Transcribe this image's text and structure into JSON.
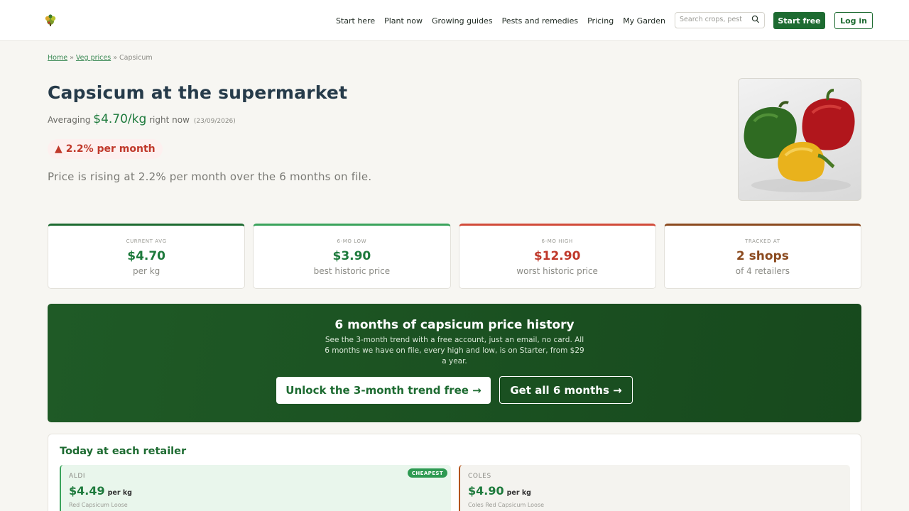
{
  "colors": {
    "brand_green": "#1d6b31",
    "price_green": "#1d7a3c",
    "rise_red": "#c0392b",
    "low_accent": "#3aa35c",
    "high_accent": "#d24b3a",
    "tracked_accent": "#8b4a1f"
  },
  "header": {
    "nav": [
      "Start here",
      "Plant now",
      "Growing guides",
      "Pests and remedies",
      "Pricing",
      "My Garden"
    ],
    "search_placeholder": "Search crops, pest",
    "start_label": "Start free",
    "login_label": "Log in",
    "logo_icon": "veggie-logo-icon",
    "search_icon": "search-icon"
  },
  "breadcrumb": {
    "home": "Home",
    "sep1": " » ",
    "prices": "Veg prices",
    "sep2": " » ",
    "current": "Capsicum"
  },
  "hero": {
    "title": "Capsicum at the supermarket",
    "avg_prefix": "Averaging ",
    "avg_price": "$4.70/kg",
    "avg_suffix": " right now",
    "date": "(23/09/2026)",
    "trend_arrow": "▲",
    "trend": "2.2% per month",
    "description": "Price is rising at 2.2% per month over the 6 months on file.",
    "image_alt": "capsicum-photo"
  },
  "stats": [
    {
      "label": "CURRENT AVG",
      "value": "$4.70",
      "sub": "per kg",
      "color": "#1d7a3c",
      "accent": "#1d6b31"
    },
    {
      "label": "6-MO LOW",
      "value": "$3.90",
      "sub": "best historic price",
      "color": "#1d7a3c",
      "accent": "#3aa35c"
    },
    {
      "label": "6-MO HIGH",
      "value": "$12.90",
      "sub": "worst historic price",
      "color": "#c0392b",
      "accent": "#d24b3a"
    },
    {
      "label": "TRACKED AT",
      "value": "2 shops",
      "sub": "of 4 retailers",
      "color": "#8b4a1f",
      "accent": "#8b4a1f"
    }
  ],
  "banner": {
    "title": "6 months of capsicum price history",
    "text": "See the 3-month trend with a free account, just an email, no card. All 6 months we have on file, every high and low, is on Starter, from $29 a year.",
    "cta_free": "Unlock the 3-month trend free →",
    "cta_paid": "Get all 6 months →"
  },
  "retailers": {
    "heading": "Today at each retailer",
    "items": [
      {
        "store": "ALDI",
        "price": "$4.49",
        "unit": "per kg",
        "product": "Red Capsicum Loose",
        "badge": "CHEAPEST"
      },
      {
        "store": "COLES",
        "price": "$4.90",
        "unit": "per kg",
        "product": "Coles Red Capsicum Loose"
      }
    ]
  }
}
